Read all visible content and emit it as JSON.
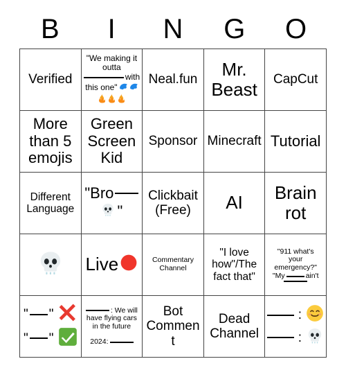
{
  "header": {
    "letters": [
      "B",
      "I",
      "N",
      "G",
      "O"
    ]
  },
  "grid": {
    "rows": 5,
    "columns": 5,
    "border_color": "#444444",
    "background": "#ffffff",
    "cells": [
      {
        "row": 1,
        "col": 1,
        "id": "cell-b1",
        "text": "Verified",
        "size": "md",
        "icons": []
      },
      {
        "row": 1,
        "col": 2,
        "id": "cell-i1",
        "text": "\"We making it outta ___ with this one\" 🗣️🗣️ 🔥🔥🔥",
        "line1": "\"We making it",
        "line2": "outta",
        "line3_suffix": "with",
        "line4": "this one\"",
        "size": "xs",
        "icons": [
          "speaking-head",
          "speaking-head",
          "fire",
          "fire",
          "fire"
        ]
      },
      {
        "row": 1,
        "col": 3,
        "id": "cell-n1",
        "text": "Neal.fun",
        "size": "md",
        "icons": []
      },
      {
        "row": 1,
        "col": 4,
        "id": "cell-g1",
        "text": "Mr. Beast",
        "line1": "Mr.",
        "line2": "Beast",
        "size": "xl",
        "icons": []
      },
      {
        "row": 1,
        "col": 5,
        "id": "cell-o1",
        "text": "CapCut",
        "size": "md",
        "icons": []
      },
      {
        "row": 2,
        "col": 1,
        "id": "cell-b2",
        "text": "More than 5 emojis",
        "line1": "More",
        "line2": "than 5",
        "line3": "emojis",
        "size": "lg",
        "icons": []
      },
      {
        "row": 2,
        "col": 2,
        "id": "cell-i2",
        "text": "Green Screen Kid",
        "line1": "Green",
        "line2": "Screen",
        "line3": "Kid",
        "size": "lg",
        "icons": []
      },
      {
        "row": 2,
        "col": 3,
        "id": "cell-n2",
        "text": "Sponsor",
        "size": "md",
        "icons": []
      },
      {
        "row": 2,
        "col": 4,
        "id": "cell-g2",
        "text": "Minecraft",
        "size": "md",
        "icons": []
      },
      {
        "row": 2,
        "col": 5,
        "id": "cell-o2",
        "text": "Tutorial",
        "size": "lg",
        "icons": []
      },
      {
        "row": 3,
        "col": 1,
        "id": "cell-b3",
        "text": "Different Language",
        "line1": "Different",
        "line2": "Language",
        "size": "sm",
        "icons": []
      },
      {
        "row": 3,
        "col": 2,
        "id": "cell-i3",
        "text": "\"Bro___ 💀\"",
        "line1_prefix": "\"Bro",
        "line2_suffix": "\"",
        "size": "lg",
        "icons": [
          "skull"
        ]
      },
      {
        "row": 3,
        "col": 3,
        "id": "cell-n3",
        "text": "Clickbait (Free)",
        "line1": "Clickbait",
        "line2": "(Free)",
        "size": "md",
        "icons": []
      },
      {
        "row": 3,
        "col": 4,
        "id": "cell-g3",
        "text": "AI",
        "size": "xl",
        "icons": []
      },
      {
        "row": 3,
        "col": 5,
        "id": "cell-o3",
        "text": "Brain rot",
        "line1": "Brain",
        "line2": "rot",
        "size": "xl",
        "icons": []
      },
      {
        "row": 4,
        "col": 1,
        "id": "cell-b4",
        "text": "💀",
        "size": "emoji-lg",
        "icons": [
          "skull"
        ]
      },
      {
        "row": 4,
        "col": 2,
        "id": "cell-i4",
        "text": "Live 🔴",
        "label": "Live",
        "size": "xl",
        "icons": [
          "red-circle"
        ]
      },
      {
        "row": 4,
        "col": 3,
        "id": "cell-n4",
        "text": "Commentary Channel",
        "line1": "Commentary",
        "line2": "Channel",
        "size": "xxs",
        "icons": []
      },
      {
        "row": 4,
        "col": 4,
        "id": "cell-g4",
        "text": "\"I love how\"/The fact that\"",
        "line1": "\"I love",
        "line2": "how\"/The",
        "line3": "fact that\"",
        "size": "sm",
        "icons": []
      },
      {
        "row": 4,
        "col": 5,
        "id": "cell-o4",
        "text": "\"911 what's your emergency?\" \"My ___ ain't ____\"",
        "line1": "\"911 what's",
        "line2": "your",
        "line3": "emergency?\"",
        "line4_prefix": "\"My",
        "line4_mid": "ain't",
        "size": "xxs",
        "icons": []
      },
      {
        "row": 5,
        "col": 1,
        "id": "cell-b5",
        "text": "\"___\" ❌ \"___\" ✅",
        "quote_open": "\"",
        "quote_close": "\"",
        "size": "md",
        "icons": [
          "cross-mark",
          "check-mark"
        ]
      },
      {
        "row": 5,
        "col": 2,
        "id": "cell-i5",
        "text": "____: We will have flying cars in the future   2024: ____",
        "line1_suffix": ": We will",
        "line2": "have flying cars",
        "line3": "in the future",
        "line4_prefix": "2024:",
        "size": "xxs",
        "icons": []
      },
      {
        "row": 5,
        "col": 3,
        "id": "cell-n5",
        "text": "Bot Comment",
        "line1": "Bot",
        "line2": "Comment",
        "size": "md",
        "icons": []
      },
      {
        "row": 5,
        "col": 4,
        "id": "cell-g5",
        "text": "Dead Channel",
        "line1": "Dead",
        "line2": "Channel",
        "size": "md",
        "icons": []
      },
      {
        "row": 5,
        "col": 5,
        "id": "cell-o5",
        "text": "___ : 😊  ___ : 💀",
        "separator": ":",
        "size": "md",
        "icons": [
          "smiling-face",
          "skull"
        ]
      }
    ]
  },
  "colors": {
    "grid_border": "#444444",
    "text": "#000000",
    "background": "#ffffff",
    "cross_mark_red": "#e8392f",
    "check_mark_green": "#5fae3c",
    "red_circle": "#f0352b",
    "skull_body": "#e9eef0",
    "fire_orange": "#f5a623",
    "speaking_head_blue": "#1f87e8",
    "smile_yellow": "#fbcb3d"
  }
}
